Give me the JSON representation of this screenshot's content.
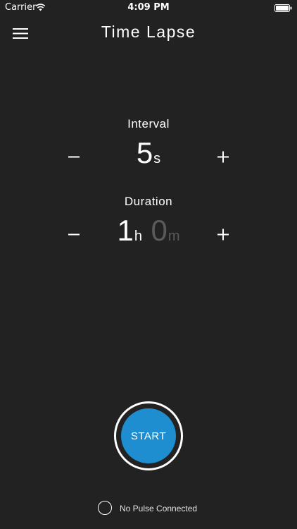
{
  "status_bar": {
    "carrier": "Carrier",
    "time": "4:09 PM"
  },
  "header": {
    "title": "Time Lapse",
    "menu_icon": "hamburger-menu-icon"
  },
  "interval": {
    "label": "Interval",
    "value": "5",
    "unit": "s"
  },
  "duration": {
    "label": "Duration",
    "hours_value": "1",
    "hours_unit": "h",
    "minutes_value": "0",
    "minutes_unit": "m"
  },
  "start_button": {
    "label": "START"
  },
  "connection": {
    "status": "No Pulse Connected"
  },
  "colors": {
    "background": "#222222",
    "accent": "#1e8ed0",
    "dim_text": "#5a5a5a"
  }
}
